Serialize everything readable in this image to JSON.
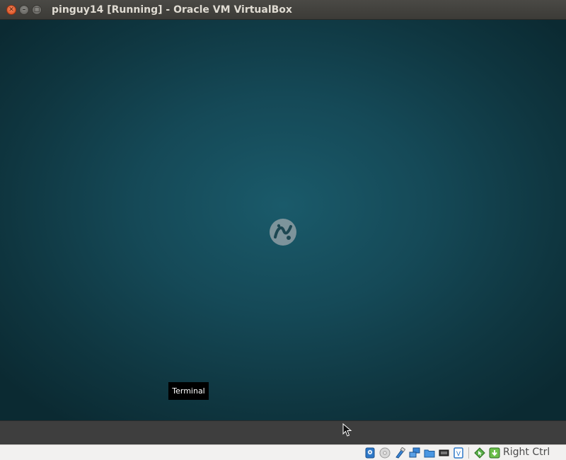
{
  "window": {
    "title": "pinguy14 [Running] - Oracle VM VirtualBox",
    "buttons": {
      "close": "close-icon",
      "minimize": "minimize-icon",
      "maximize": "maximize-icon"
    }
  },
  "guest": {
    "background_color": "#154957",
    "logo": "pinguy-logo-icon",
    "tooltip": "Terminal"
  },
  "statusbar": {
    "icons": [
      "hard-disk-icon",
      "optical-drive-icon",
      "usb-icon",
      "network-icon",
      "shared-folders-icon",
      "display-icon",
      "video-capture-icon",
      "cpu-virtualization-icon",
      "mouse-integration-icon",
      "keyboard-capture-icon"
    ],
    "host_key": "Right Ctrl"
  }
}
